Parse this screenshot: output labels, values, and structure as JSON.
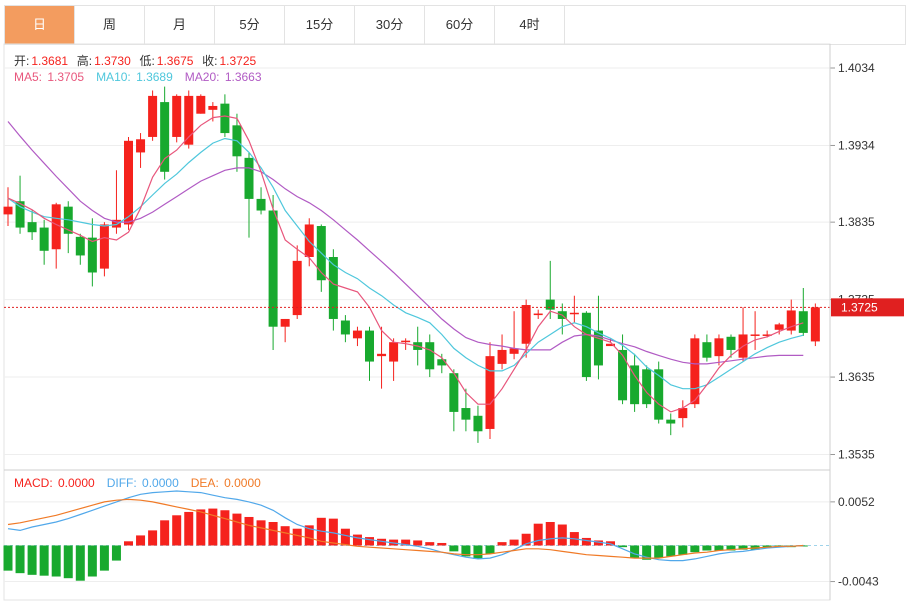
{
  "tabs": [
    {
      "label": "日",
      "active": true
    },
    {
      "label": "周",
      "active": false
    },
    {
      "label": "月",
      "active": false
    },
    {
      "label": "5分",
      "active": false
    },
    {
      "label": "15分",
      "active": false
    },
    {
      "label": "30分",
      "active": false
    },
    {
      "label": "60分",
      "active": false
    },
    {
      "label": "4时",
      "active": false
    }
  ],
  "ohlc_info": {
    "open_label": "开:",
    "open": "1.3681",
    "high_label": "高:",
    "high": "1.3730",
    "low_label": "低:",
    "low": "1.3675",
    "close_label": "收:",
    "close": "1.3725"
  },
  "ma_info": {
    "ma5_label": "MA5: ",
    "ma5": "1.3705",
    "ma10_label": "MA10: ",
    "ma10": "1.3689",
    "ma20_label": "MA20: ",
    "ma20": "1.3663"
  },
  "macd_info": {
    "macd_label": "MACD: ",
    "macd": "0.0000",
    "diff_label": "DIFF: ",
    "diff": "0.0000",
    "dea_label": "DEA: ",
    "dea": "0.0000"
  },
  "colors": {
    "up": "#f5221d",
    "down": "#18a92e",
    "ma5": "#e8567c",
    "ma10": "#4fc7dc",
    "ma20": "#b15bc4",
    "diff": "#51a8ea",
    "dea": "#f07a27",
    "current": "#e02020",
    "tab_active": "#f39c5f"
  },
  "chart_data": {
    "type": "candlestick",
    "price_axis": {
      "ylim": [
        1.3515,
        1.4065
      ],
      "ticks": [
        "1.4034",
        "1.3934",
        "1.3835",
        "1.3735",
        "1.3635",
        "1.3535"
      ]
    },
    "current_price": "1.3725",
    "macd_axis": {
      "ylim": [
        -0.0065,
        0.009
      ],
      "ticks": [
        "0.0052",
        "-0.0043"
      ]
    },
    "candles": [
      [
        1.3845,
        1.388,
        1.383,
        1.3855
      ],
      [
        1.3862,
        1.3895,
        1.382,
        1.3828
      ],
      [
        1.3835,
        1.385,
        1.3812,
        1.3822
      ],
      [
        1.3828,
        1.3838,
        1.378,
        1.3798
      ],
      [
        1.38,
        1.386,
        1.3775,
        1.3858
      ],
      [
        1.3855,
        1.3862,
        1.3795,
        1.382
      ],
      [
        1.3816,
        1.382,
        1.378,
        1.3792
      ],
      [
        1.3815,
        1.384,
        1.3752,
        1.377
      ],
      [
        1.3775,
        1.3835,
        1.3765,
        1.3832
      ],
      [
        1.3828,
        1.3902,
        1.382,
        1.3838
      ],
      [
        1.3832,
        1.3945,
        1.3825,
        1.394
      ],
      [
        1.3925,
        1.395,
        1.3905,
        1.3942
      ],
      [
        1.3945,
        1.4005,
        1.394,
        1.3998
      ],
      [
        1.399,
        1.401,
        1.389,
        1.39
      ],
      [
        1.3945,
        1.4,
        1.3938,
        1.3998
      ],
      [
        1.3935,
        1.4005,
        1.393,
        1.3998
      ],
      [
        1.3975,
        1.4,
        1.3975,
        1.3998
      ],
      [
        1.398,
        1.399,
        1.3965,
        1.3985
      ],
      [
        1.3988,
        1.4,
        1.3945,
        1.395
      ],
      [
        1.396,
        1.3975,
        1.39,
        1.392
      ],
      [
        1.3918,
        1.3925,
        1.3815,
        1.3865
      ],
      [
        1.3865,
        1.388,
        1.3845,
        1.385
      ],
      [
        1.385,
        1.387,
        1.367,
        1.37
      ],
      [
        1.37,
        1.371,
        1.368,
        1.371
      ],
      [
        1.3715,
        1.3805,
        1.371,
        1.3785
      ],
      [
        1.379,
        1.384,
        1.3778,
        1.3832
      ],
      [
        1.383,
        1.3832,
        1.3745,
        1.376
      ],
      [
        1.379,
        1.38,
        1.3695,
        1.371
      ],
      [
        1.3708,
        1.3715,
        1.368,
        1.369
      ],
      [
        1.3685,
        1.37,
        1.3675,
        1.3695
      ],
      [
        1.3695,
        1.37,
        1.363,
        1.3655
      ],
      [
        1.3662,
        1.37,
        1.362,
        1.3665
      ],
      [
        1.3655,
        1.3685,
        1.363,
        1.368
      ],
      [
        1.368,
        1.3685,
        1.367,
        1.3682
      ],
      [
        1.368,
        1.37,
        1.365,
        1.367
      ],
      [
        1.368,
        1.369,
        1.3635,
        1.3645
      ],
      [
        1.3658,
        1.3665,
        1.364,
        1.365
      ],
      [
        1.364,
        1.3645,
        1.3565,
        1.359
      ],
      [
        1.3595,
        1.362,
        1.3565,
        1.358
      ],
      [
        1.3585,
        1.3598,
        1.355,
        1.3565
      ],
      [
        1.3568,
        1.368,
        1.3555,
        1.3662
      ],
      [
        1.3652,
        1.369,
        1.3645,
        1.367
      ],
      [
        1.3665,
        1.372,
        1.3658,
        1.3672
      ],
      [
        1.3678,
        1.3735,
        1.366,
        1.3728
      ],
      [
        1.3715,
        1.3722,
        1.371,
        1.3717
      ],
      [
        1.3735,
        1.3785,
        1.371,
        1.3722
      ],
      [
        1.372,
        1.373,
        1.369,
        1.371
      ],
      [
        1.3718,
        1.374,
        1.3705,
        1.3718
      ],
      [
        1.3718,
        1.372,
        1.363,
        1.3635
      ],
      [
        1.3695,
        1.374,
        1.3632,
        1.365
      ],
      [
        1.3675,
        1.3685,
        1.368,
        1.3678
      ],
      [
        1.367,
        1.369,
        1.36,
        1.3605
      ],
      [
        1.365,
        1.3665,
        1.359,
        1.36
      ],
      [
        1.3645,
        1.365,
        1.3595,
        1.36
      ],
      [
        1.3645,
        1.3655,
        1.3575,
        1.358
      ],
      [
        1.358,
        1.3588,
        1.356,
        1.3575
      ],
      [
        1.3582,
        1.3605,
        1.357,
        1.3595
      ],
      [
        1.36,
        1.369,
        1.3595,
        1.3685
      ],
      [
        1.368,
        1.369,
        1.3655,
        1.366
      ],
      [
        1.3662,
        1.369,
        1.365,
        1.3685
      ],
      [
        1.3687,
        1.369,
        1.366,
        1.367
      ],
      [
        1.366,
        1.3725,
        1.3655,
        1.369
      ],
      [
        1.369,
        1.372,
        1.367,
        1.369
      ],
      [
        1.369,
        1.3695,
        1.3686,
        1.369
      ],
      [
        1.3696,
        1.3705,
        1.369,
        1.3703
      ],
      [
        1.3695,
        1.3735,
        1.369,
        1.3721
      ],
      [
        1.372,
        1.375,
        1.3688,
        1.3692
      ],
      [
        1.3681,
        1.373,
        1.3675,
        1.3725
      ]
    ],
    "ma5": [
      1.3866,
      1.3859,
      1.3851,
      1.384,
      1.3832,
      1.3825,
      1.3818,
      1.381,
      1.3815,
      1.3812,
      1.3822,
      1.3853,
      1.3893,
      1.3917,
      1.3928,
      1.3945,
      1.396,
      1.397,
      1.3972,
      1.3969,
      1.394,
      1.39,
      1.3852,
      1.3812,
      1.38,
      1.3789,
      1.377,
      1.3755,
      1.375,
      1.3745,
      1.3725,
      1.3695,
      1.368,
      1.3678,
      1.3675,
      1.367,
      1.366,
      1.364,
      1.3615,
      1.36,
      1.36,
      1.362,
      1.3645,
      1.367,
      1.37,
      1.372,
      1.3715,
      1.37,
      1.369,
      1.3685,
      1.368,
      1.3663,
      1.3637,
      1.3615,
      1.36,
      1.359,
      1.3595,
      1.3605,
      1.3625,
      1.3647,
      1.3663,
      1.3675,
      1.3683,
      1.3687,
      1.3694,
      1.37,
      1.3705
    ],
    "ma10": [
      1.3866,
      1.3855,
      1.3848,
      1.3842,
      1.384,
      1.3838,
      1.3835,
      1.3832,
      1.383,
      1.3832,
      1.3842,
      1.3855,
      1.387,
      1.3885,
      1.3897,
      1.3912,
      1.3925,
      1.3937,
      1.3943,
      1.394,
      1.3925,
      1.3905,
      1.388,
      1.385,
      1.383,
      1.381,
      1.3795,
      1.378,
      1.377,
      1.3762,
      1.375,
      1.374,
      1.3728,
      1.3718,
      1.3712,
      1.3705,
      1.369,
      1.3672,
      1.366,
      1.365,
      1.3643,
      1.3643,
      1.365,
      1.3665,
      1.368,
      1.369,
      1.37,
      1.3705,
      1.37,
      1.3692,
      1.3685,
      1.3676,
      1.3664,
      1.3648,
      1.3637,
      1.3625,
      1.362,
      1.362,
      1.3625,
      1.3635,
      1.3645,
      1.3655,
      1.3665,
      1.3673,
      1.368,
      1.3685,
      1.3689
    ],
    "ma20": [
      1.3965,
      1.3946,
      1.3928,
      1.3911,
      1.3894,
      1.3878,
      1.3862,
      1.385,
      1.384,
      1.3835,
      1.3835,
      1.384,
      1.3848,
      1.3858,
      1.3868,
      1.3878,
      1.3888,
      1.3895,
      1.3902,
      1.3905,
      1.3905,
      1.39,
      1.389,
      1.3878,
      1.3868,
      1.386,
      1.385,
      1.3838,
      1.3825,
      1.3812,
      1.3798,
      1.3784,
      1.377,
      1.3755,
      1.374,
      1.3725,
      1.371,
      1.3697,
      1.3686,
      1.368,
      1.3677,
      1.3675,
      1.3672,
      1.367,
      1.367,
      1.367,
      1.368,
      1.3688,
      1.369,
      1.3688,
      1.3683,
      1.3678,
      1.3674,
      1.3668,
      1.3663,
      1.3658,
      1.3654,
      1.3652,
      1.3652,
      1.3654,
      1.3656,
      1.3658,
      1.366,
      1.3662,
      1.3663,
      1.3663,
      1.3663
    ],
    "macd_hist": [
      -0.003,
      -0.0033,
      -0.0035,
      -0.0036,
      -0.0037,
      -0.0039,
      -0.0042,
      -0.0037,
      -0.003,
      -0.0018,
      0.0005,
      0.0012,
      0.0018,
      0.003,
      0.0036,
      0.004,
      0.0043,
      0.0044,
      0.0042,
      0.0038,
      0.0034,
      0.003,
      0.0028,
      0.0023,
      0.002,
      0.0024,
      0.0033,
      0.0032,
      0.002,
      0.0013,
      0.001,
      0.0008,
      0.0007,
      0.0007,
      0.0006,
      0.0004,
      0.0003,
      -0.0007,
      -0.0013,
      -0.0016,
      -0.001,
      0.0004,
      0.0007,
      0.0014,
      0.0026,
      0.0028,
      0.0025,
      0.0016,
      0.0009,
      0.0006,
      0.0005,
      -0.0002,
      -0.0015,
      -0.0017,
      -0.0015,
      -0.0013,
      -0.0011,
      -0.0008,
      -0.0006,
      -0.0006,
      -0.0006,
      -0.0005,
      -0.0005,
      -0.0003,
      -0.0002,
      -0.0002,
      -0.0001
    ],
    "diff": [
      0.002,
      0.0018,
      0.0022,
      0.0025,
      0.0028,
      0.0032,
      0.0037,
      0.0042,
      0.0047,
      0.0052,
      0.0057,
      0.0061,
      0.0063,
      0.0064,
      0.0065,
      0.0064,
      0.0063,
      0.006,
      0.0057,
      0.0055,
      0.0052,
      0.0048,
      0.0042,
      0.0033,
      0.0025,
      0.002,
      0.0017,
      0.0015,
      0.0012,
      0.0009,
      0.0007,
      0.0005,
      0.0003,
      0.0001,
      -0.0001,
      -0.0004,
      -0.0008,
      -0.0011,
      -0.0014,
      -0.0016,
      -0.0015,
      -0.0011,
      -0.0005,
      0.0002,
      0.0006,
      0.0008,
      0.0009,
      0.0008,
      0.0006,
      0.0004,
      0.0002,
      -0.0004,
      -0.001,
      -0.0014,
      -0.0017,
      -0.0018,
      -0.0018,
      -0.0016,
      -0.0013,
      -0.001,
      -0.0008,
      -0.0007,
      -0.0005,
      -0.0003,
      -0.0002,
      -0.0001,
      0.0
    ],
    "dea": [
      0.0025,
      0.0027,
      0.003,
      0.0033,
      0.0036,
      0.004,
      0.0044,
      0.0048,
      0.0052,
      0.0054,
      0.0055,
      0.0054,
      0.0052,
      0.0049,
      0.0046,
      0.0043,
      0.004,
      0.0036,
      0.0032,
      0.0028,
      0.0024,
      0.0021,
      0.0018,
      0.0015,
      0.0012,
      0.0009,
      0.0005,
      0.0003,
      0.0001,
      -0.0001,
      -0.0002,
      -0.0003,
      -0.0004,
      -0.0005,
      -0.0006,
      -0.0007,
      -0.0008,
      -0.001,
      -0.0011,
      -0.0011,
      -0.001,
      -0.0008,
      -0.0006,
      -0.0004,
      -0.0004,
      -0.0005,
      -0.0007,
      -0.0009,
      -0.0011,
      -0.0012,
      -0.0013,
      -0.0014,
      -0.0015,
      -0.0015,
      -0.0015,
      -0.0013,
      -0.0011,
      -0.0009,
      -0.0008,
      -0.0006,
      -0.0005,
      -0.0004,
      -0.0003,
      -0.0002,
      -0.0001,
      -0.0001,
      0.0
    ]
  }
}
